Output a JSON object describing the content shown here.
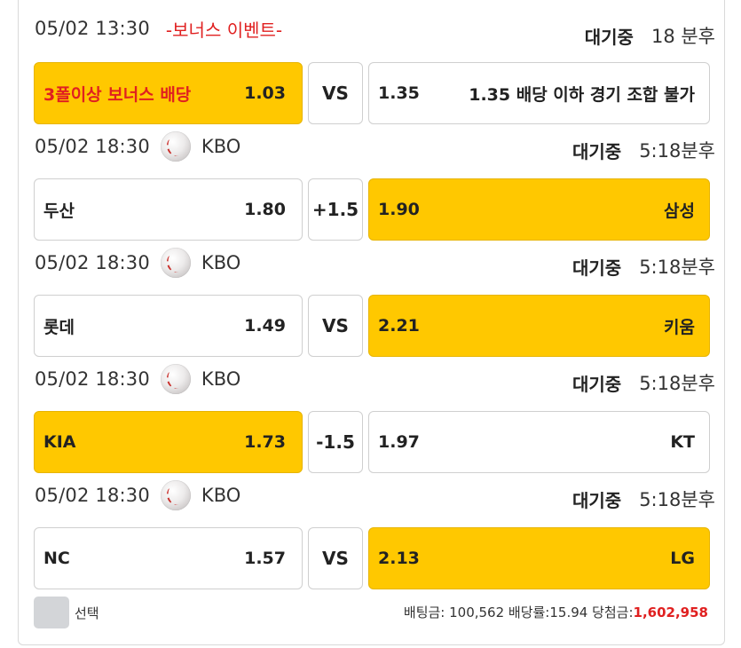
{
  "games": [
    {
      "date": "05/02 13:30",
      "event": "-보너스 이벤트-",
      "league": "",
      "status": "대기중",
      "remain": "18 분후",
      "home": {
        "team": "3폴이상 보너스 배당",
        "odds": "1.03"
      },
      "mid": "VS",
      "away": {
        "odds": "1.35",
        "team": "1.35 배당 이하 경기 조합 불가"
      }
    },
    {
      "date": "05/02 18:30",
      "league": "KBO",
      "status": "대기중",
      "remain": "5:18분후",
      "home": {
        "team": "두산",
        "odds": "1.80"
      },
      "mid": "+1.5",
      "away": {
        "odds": "1.90",
        "team": "삼성"
      }
    },
    {
      "date": "05/02 18:30",
      "league": "KBO",
      "status": "대기중",
      "remain": "5:18분후",
      "home": {
        "team": "롯데",
        "odds": "1.49"
      },
      "mid": "VS",
      "away": {
        "odds": "2.21",
        "team": "키움"
      }
    },
    {
      "date": "05/02 18:30",
      "league": "KBO",
      "status": "대기중",
      "remain": "5:18분후",
      "home": {
        "team": "KIA",
        "odds": "1.73"
      },
      "mid": "-1.5",
      "away": {
        "odds": "1.97",
        "team": "KT"
      }
    },
    {
      "date": "05/02 18:30",
      "league": "KBO",
      "status": "대기중",
      "remain": "5:18분후",
      "home": {
        "team": "NC",
        "odds": "1.57"
      },
      "mid": "VS",
      "away": {
        "odds": "2.13",
        "team": "LG"
      }
    }
  ],
  "footer": {
    "select_label": "선택",
    "bet_prefix": "배팅금: 100,562 배당률:15.94 당첨금:",
    "win_amount": "1,602,958"
  },
  "colors": {
    "selected": "#ffc800",
    "accent_red": "#e02020",
    "checkbox": "#d3d5d8"
  }
}
